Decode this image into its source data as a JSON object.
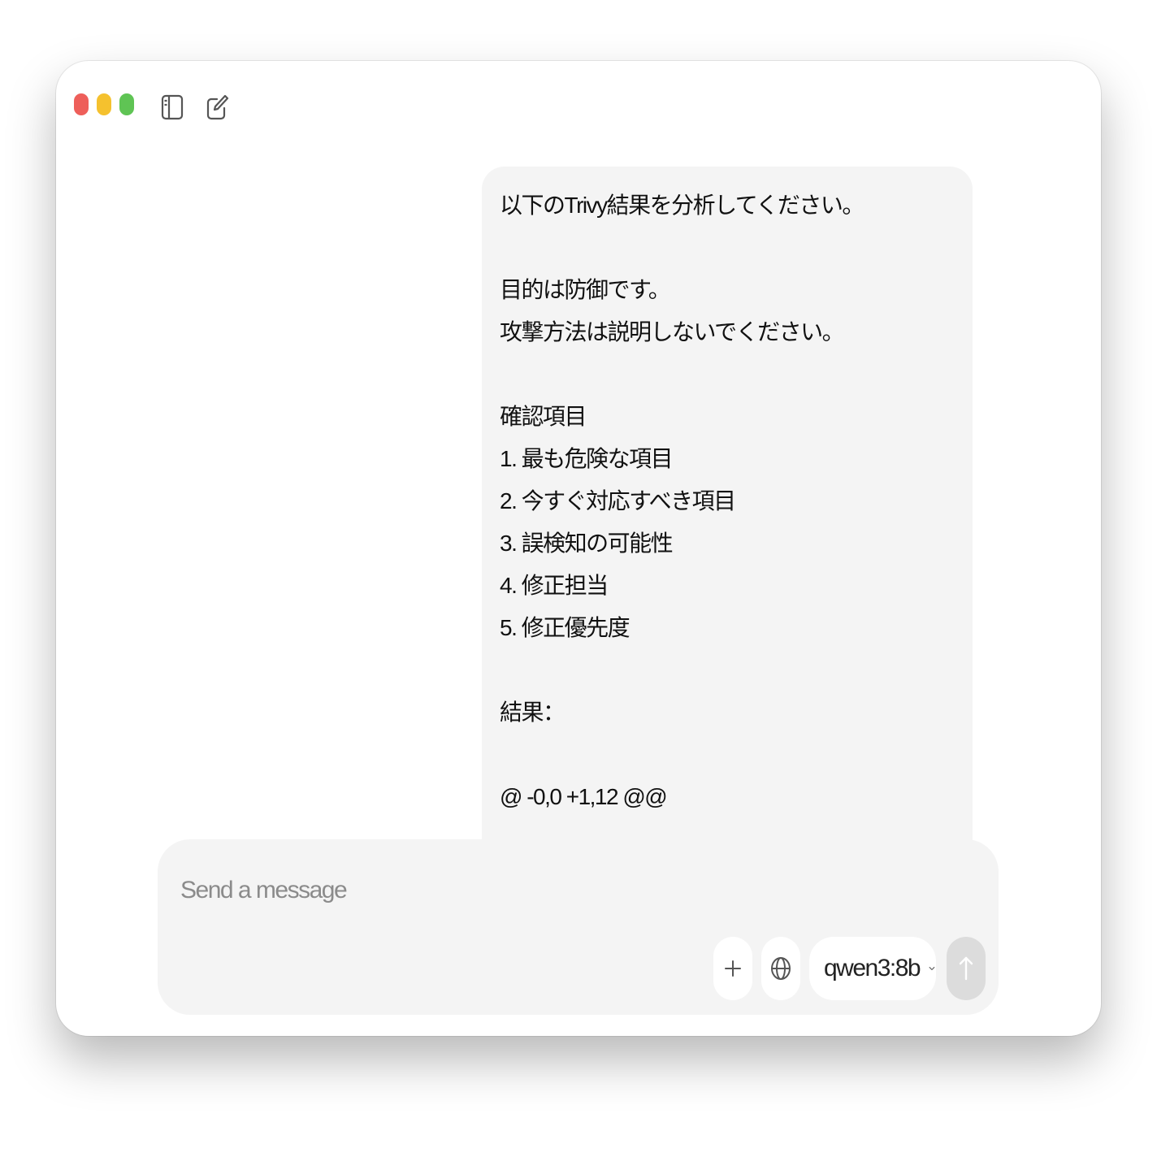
{
  "window": {
    "traffic_lights": {
      "close": "#ee5f5a",
      "minimize": "#f5c12e",
      "zoom": "#5fc454"
    },
    "icons": [
      "sidebar-toggle-icon",
      "new-chat-icon"
    ]
  },
  "message": {
    "lines": [
      "以下のTrivy結果を分析してください。",
      "",
      "目的は防御です。",
      "攻撃方法は説明しないでください。",
      "",
      "確認項目",
      "1. 最も危険な項目",
      "2. 今すぐ対応すべき項目",
      "3. 誤検知の可能性",
      "4. 修正担当",
      "5. 修正優先度",
      "",
      "結果：",
      "",
      "@ -0,0 +1,12 @@"
    ]
  },
  "composer": {
    "placeholder": "Send a message",
    "value": "",
    "model": "qwen3:8b",
    "icons": [
      "plus-icon",
      "globe-icon",
      "chevron-down-icon",
      "arrow-up-icon"
    ]
  }
}
